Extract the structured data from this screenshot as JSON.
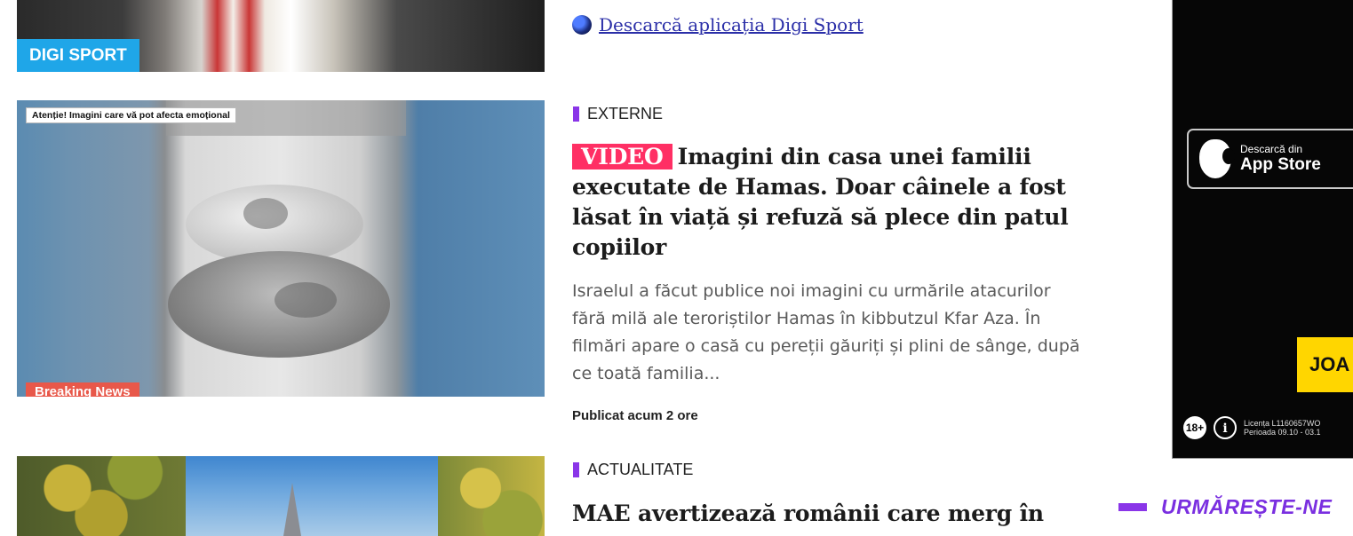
{
  "articles": [
    {
      "thumb_badge": "DIGI SPORT",
      "app_link": "Descarcă aplicația Digi Sport"
    },
    {
      "category": "EXTERNE",
      "video_tag": "VIDEO",
      "headline": "Imagini din casa unei familii executate de Hamas. Doar câinele a fost lăsat în viață și refuză să plece din patul copiilor",
      "summary": "Israelul a făcut publice noi imagini cu urmările atacurilor fără milă ale teroriștilor Hamas în kibbutzul Kfar Aza. În filmări apare o casă cu pereții găuriți și plini de sânge, după ce toată familia...",
      "published": "Publicat acum 2 ore",
      "thumb_warning": "Atenție! Imagini care vă pot afecta emoțional",
      "thumb_breaking": "Breaking News"
    },
    {
      "category": "ACTUALITATE",
      "headline": "MAE avertizează românii care merg în"
    }
  ],
  "ad": {
    "store_small": "Descarcă din",
    "store_big": "App Store",
    "cta": "JOA",
    "age": "18+",
    "license_line1": "Licența L1160657WO",
    "license_line2": "Perioada 09.10 - 03.1"
  },
  "follow_us": "URMĂREȘTE-NE",
  "colors": {
    "accent_purple": "#8a35e8",
    "video_pink": "#ff2f64",
    "digi_blue": "#1fa6e8",
    "link_blue": "#2b2fa8",
    "ad_yellow": "#ffd600"
  },
  "icons": [
    "digi-app-icon",
    "apple-icon",
    "age-18-icon",
    "info-icon"
  ]
}
